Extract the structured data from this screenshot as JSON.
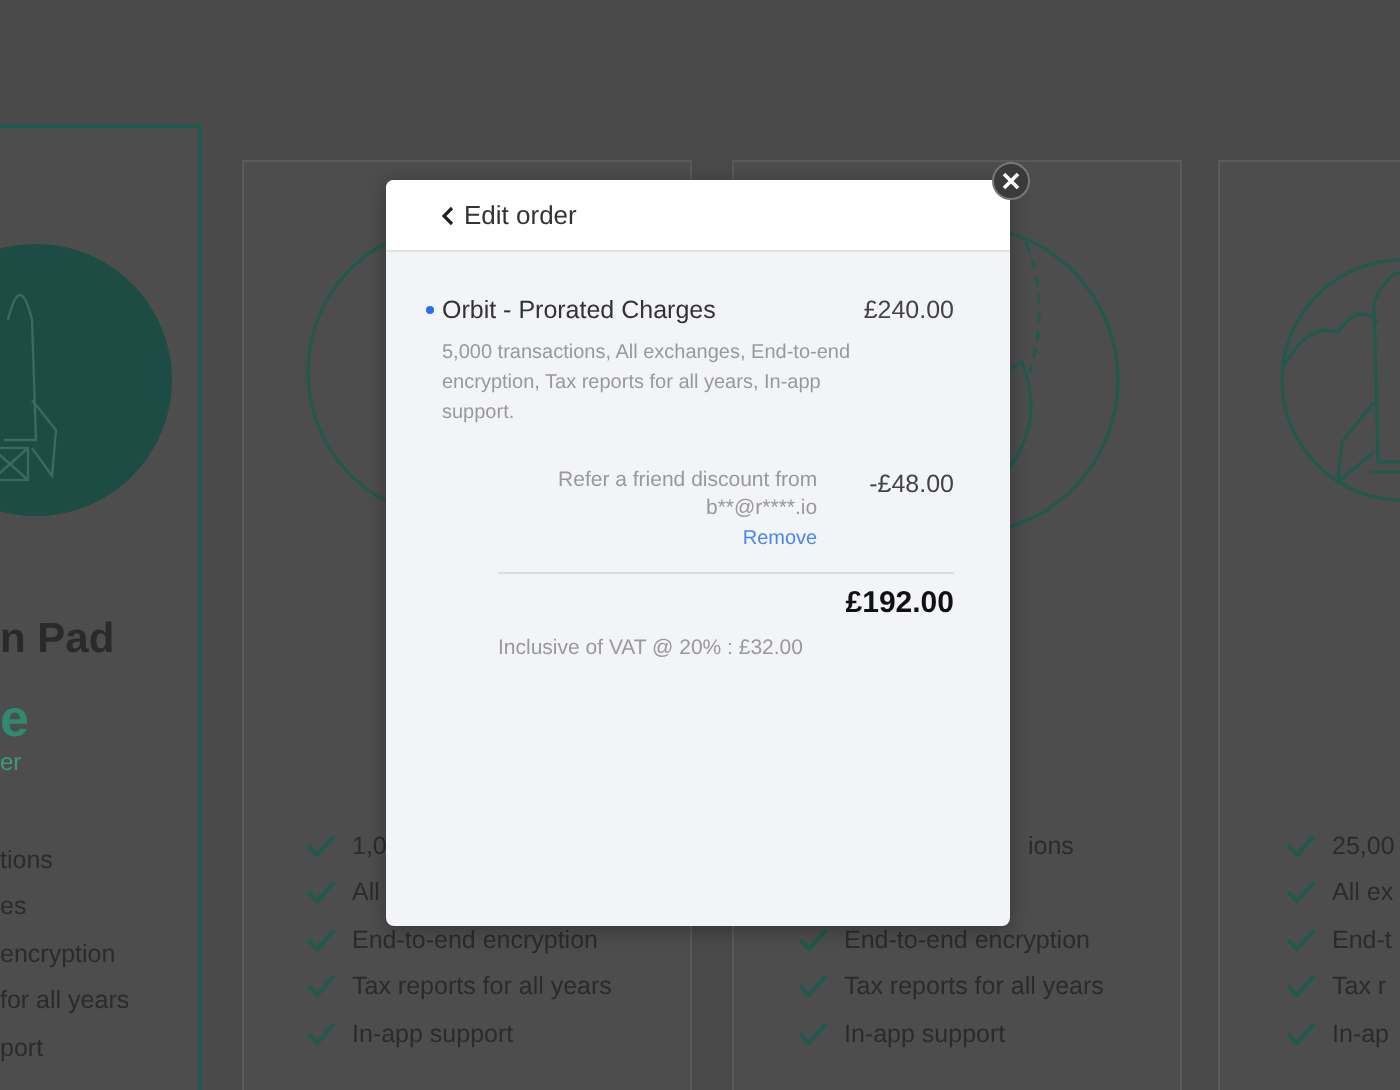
{
  "plans": [
    {
      "kind": "filled-rocket",
      "highlighted": true,
      "name": "n Pad",
      "price": "e",
      "price_note": "er",
      "features": [
        {
          "text": "tions",
          "check": false
        },
        {
          "text": "es",
          "check": false
        },
        {
          "text": "encryption",
          "check": false
        },
        {
          "text": "for all years",
          "check": false
        },
        {
          "text": "port",
          "check": false
        }
      ]
    },
    {
      "kind": "circle",
      "highlighted": false,
      "features": [
        {
          "text": "1,0",
          "check": true
        },
        {
          "text": "All",
          "check": true
        },
        {
          "text": "End-to-end encryption",
          "check": true
        },
        {
          "text": "Tax reports for all years",
          "check": true
        },
        {
          "text": "In-app support",
          "check": true
        }
      ]
    },
    {
      "kind": "globe",
      "highlighted": false,
      "features": [
        {
          "text": "ions",
          "check": false
        },
        {
          "text": "End-to-end encryption",
          "check": true
        },
        {
          "text": "Tax reports for all years",
          "check": true
        },
        {
          "text": "In-app support",
          "check": true
        }
      ]
    },
    {
      "kind": "rocket",
      "highlighted": false,
      "features": [
        {
          "text": "25,00",
          "check": true
        },
        {
          "text": "All ex",
          "check": true
        },
        {
          "text": "End-t",
          "check": true
        },
        {
          "text": "Tax r",
          "check": true
        },
        {
          "text": "In-ap",
          "check": true
        }
      ]
    }
  ],
  "modal": {
    "back_label": "Edit order",
    "line_item": {
      "title": "Orbit - Prorated Charges",
      "amount": "£240.00",
      "description": "5,000 transactions, All exchanges, End-to-end encryption, Tax reports for all years, In-app support."
    },
    "discount": {
      "label": "Refer a friend discount from b**@r****.io",
      "amount": "-£48.00",
      "action": "Remove"
    },
    "total": "£192.00",
    "vat_note": "Inclusive of VAT @ 20% : £32.00"
  }
}
